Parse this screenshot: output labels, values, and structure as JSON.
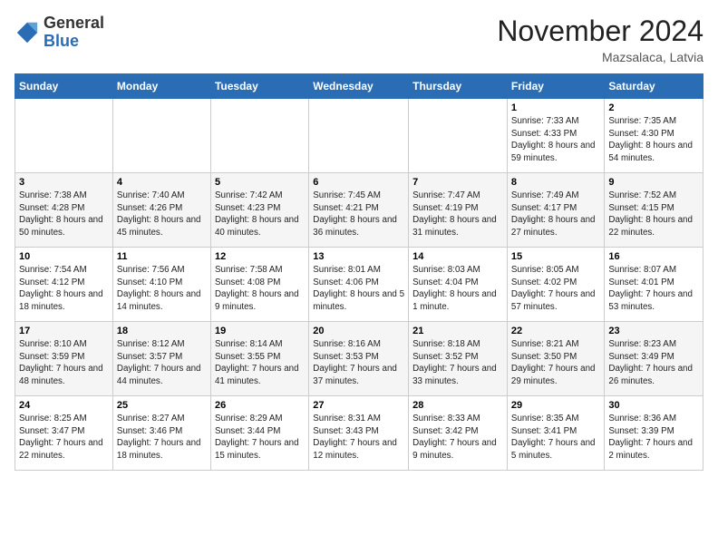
{
  "logo": {
    "general": "General",
    "blue": "Blue"
  },
  "header": {
    "title": "November 2024",
    "location": "Mazsalaca, Latvia"
  },
  "days_of_week": [
    "Sunday",
    "Monday",
    "Tuesday",
    "Wednesday",
    "Thursday",
    "Friday",
    "Saturday"
  ],
  "weeks": [
    [
      {
        "day": "",
        "info": ""
      },
      {
        "day": "",
        "info": ""
      },
      {
        "day": "",
        "info": ""
      },
      {
        "day": "",
        "info": ""
      },
      {
        "day": "",
        "info": ""
      },
      {
        "day": "1",
        "info": "Sunrise: 7:33 AM\nSunset: 4:33 PM\nDaylight: 8 hours and 59 minutes."
      },
      {
        "day": "2",
        "info": "Sunrise: 7:35 AM\nSunset: 4:30 PM\nDaylight: 8 hours and 54 minutes."
      }
    ],
    [
      {
        "day": "3",
        "info": "Sunrise: 7:38 AM\nSunset: 4:28 PM\nDaylight: 8 hours and 50 minutes."
      },
      {
        "day": "4",
        "info": "Sunrise: 7:40 AM\nSunset: 4:26 PM\nDaylight: 8 hours and 45 minutes."
      },
      {
        "day": "5",
        "info": "Sunrise: 7:42 AM\nSunset: 4:23 PM\nDaylight: 8 hours and 40 minutes."
      },
      {
        "day": "6",
        "info": "Sunrise: 7:45 AM\nSunset: 4:21 PM\nDaylight: 8 hours and 36 minutes."
      },
      {
        "day": "7",
        "info": "Sunrise: 7:47 AM\nSunset: 4:19 PM\nDaylight: 8 hours and 31 minutes."
      },
      {
        "day": "8",
        "info": "Sunrise: 7:49 AM\nSunset: 4:17 PM\nDaylight: 8 hours and 27 minutes."
      },
      {
        "day": "9",
        "info": "Sunrise: 7:52 AM\nSunset: 4:15 PM\nDaylight: 8 hours and 22 minutes."
      }
    ],
    [
      {
        "day": "10",
        "info": "Sunrise: 7:54 AM\nSunset: 4:12 PM\nDaylight: 8 hours and 18 minutes."
      },
      {
        "day": "11",
        "info": "Sunrise: 7:56 AM\nSunset: 4:10 PM\nDaylight: 8 hours and 14 minutes."
      },
      {
        "day": "12",
        "info": "Sunrise: 7:58 AM\nSunset: 4:08 PM\nDaylight: 8 hours and 9 minutes."
      },
      {
        "day": "13",
        "info": "Sunrise: 8:01 AM\nSunset: 4:06 PM\nDaylight: 8 hours and 5 minutes."
      },
      {
        "day": "14",
        "info": "Sunrise: 8:03 AM\nSunset: 4:04 PM\nDaylight: 8 hours and 1 minute."
      },
      {
        "day": "15",
        "info": "Sunrise: 8:05 AM\nSunset: 4:02 PM\nDaylight: 7 hours and 57 minutes."
      },
      {
        "day": "16",
        "info": "Sunrise: 8:07 AM\nSunset: 4:01 PM\nDaylight: 7 hours and 53 minutes."
      }
    ],
    [
      {
        "day": "17",
        "info": "Sunrise: 8:10 AM\nSunset: 3:59 PM\nDaylight: 7 hours and 48 minutes."
      },
      {
        "day": "18",
        "info": "Sunrise: 8:12 AM\nSunset: 3:57 PM\nDaylight: 7 hours and 44 minutes."
      },
      {
        "day": "19",
        "info": "Sunrise: 8:14 AM\nSunset: 3:55 PM\nDaylight: 7 hours and 41 minutes."
      },
      {
        "day": "20",
        "info": "Sunrise: 8:16 AM\nSunset: 3:53 PM\nDaylight: 7 hours and 37 minutes."
      },
      {
        "day": "21",
        "info": "Sunrise: 8:18 AM\nSunset: 3:52 PM\nDaylight: 7 hours and 33 minutes."
      },
      {
        "day": "22",
        "info": "Sunrise: 8:21 AM\nSunset: 3:50 PM\nDaylight: 7 hours and 29 minutes."
      },
      {
        "day": "23",
        "info": "Sunrise: 8:23 AM\nSunset: 3:49 PM\nDaylight: 7 hours and 26 minutes."
      }
    ],
    [
      {
        "day": "24",
        "info": "Sunrise: 8:25 AM\nSunset: 3:47 PM\nDaylight: 7 hours and 22 minutes."
      },
      {
        "day": "25",
        "info": "Sunrise: 8:27 AM\nSunset: 3:46 PM\nDaylight: 7 hours and 18 minutes."
      },
      {
        "day": "26",
        "info": "Sunrise: 8:29 AM\nSunset: 3:44 PM\nDaylight: 7 hours and 15 minutes."
      },
      {
        "day": "27",
        "info": "Sunrise: 8:31 AM\nSunset: 3:43 PM\nDaylight: 7 hours and 12 minutes."
      },
      {
        "day": "28",
        "info": "Sunrise: 8:33 AM\nSunset: 3:42 PM\nDaylight: 7 hours and 9 minutes."
      },
      {
        "day": "29",
        "info": "Sunrise: 8:35 AM\nSunset: 3:41 PM\nDaylight: 7 hours and 5 minutes."
      },
      {
        "day": "30",
        "info": "Sunrise: 8:36 AM\nSunset: 3:39 PM\nDaylight: 7 hours and 2 minutes."
      }
    ]
  ]
}
